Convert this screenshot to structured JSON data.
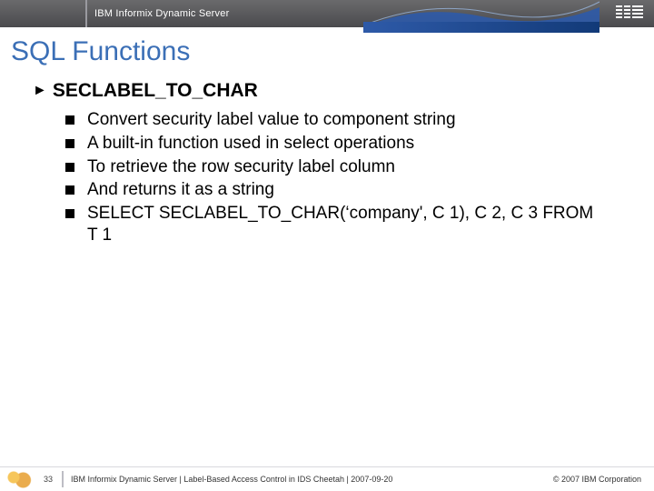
{
  "header": {
    "title": "IBM Informix Dynamic Server",
    "logo_alt": "IBM"
  },
  "slide": {
    "title": "SQL Functions",
    "heading": "SECLABEL_TO_CHAR",
    "bullets": [
      "Convert security label value to component string",
      "A built-in function used in select operations",
      "To retrieve the row security label column",
      "And returns it as a string",
      "SELECT SECLABEL_TO_CHAR(‘company', C 1), C 2, C 3 FROM T 1"
    ]
  },
  "footer": {
    "page": "33",
    "text": "IBM Informix Dynamic Server  |  Label-Based Access Control in IDS Cheetah | 2007-09-20",
    "copyright": "© 2007 IBM Corporation"
  }
}
